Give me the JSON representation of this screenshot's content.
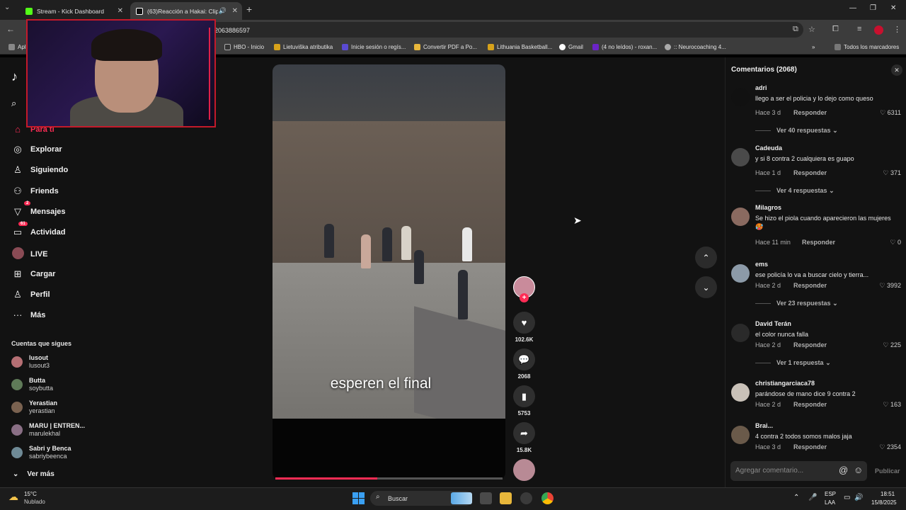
{
  "browser": {
    "tabs": [
      {
        "title": "Stream - Kick Dashboard",
        "favicon_color": "#53fc18"
      },
      {
        "title": "(63)Reacción a Hakai: Clips",
        "favicon_color": "#ffffff"
      }
    ],
    "url": "2063886597",
    "bookmarks": [
      {
        "label": "HBO - Inicio",
        "color": "#333333"
      },
      {
        "label": "Lietuviška atributika",
        "color": "#d7a21a"
      },
      {
        "label": "Inicie sesión o regís...",
        "color": "#5a4ad1"
      },
      {
        "label": "Convertir PDF a Po...",
        "color": "#e8b73b"
      },
      {
        "label": "Lithuania Basketball...",
        "color": "#d7a21a"
      },
      {
        "label": "Gmail",
        "color": "#ffffff"
      },
      {
        "label": "(4 no leídos) - roxan...",
        "color": "#6b24c7"
      },
      {
        "label": ":: Neurocoaching 4...",
        "color": "#aaaaaa"
      }
    ],
    "bookmarks_left": "Apl",
    "all_bookmarks": "Todos los marcadores"
  },
  "sidebar": {
    "items": [
      {
        "label": "Para ti",
        "icon": "home-icon",
        "badge": ""
      },
      {
        "label": "Explorar",
        "icon": "compass-icon",
        "badge": ""
      },
      {
        "label": "Siguiendo",
        "icon": "person-icon",
        "badge": ""
      },
      {
        "label": "Friends",
        "icon": "friends-icon",
        "badge": ""
      },
      {
        "label": "Mensajes",
        "icon": "send-icon",
        "badge": "2"
      },
      {
        "label": "Actividad",
        "icon": "inbox-icon",
        "badge": "61"
      },
      {
        "label": "LIVE",
        "icon": "live-icon",
        "badge": ""
      },
      {
        "label": "Cargar",
        "icon": "plus-square-icon",
        "badge": ""
      },
      {
        "label": "Perfil",
        "icon": "profile-icon",
        "badge": ""
      },
      {
        "label": "Más",
        "icon": "more-icon",
        "badge": ""
      }
    ],
    "following_title": "Cuentas que sigues",
    "accounts": [
      {
        "name": "lusout",
        "handle": "lusout3",
        "color": "#b56f74"
      },
      {
        "name": "Butta",
        "handle": "soybutta",
        "color": "#5f7a58"
      },
      {
        "name": "Yerastian",
        "handle": "yerastian",
        "color": "#7a6250"
      },
      {
        "name": "MARU | ENTREN...",
        "handle": "marulekhal",
        "color": "#8a6f85"
      },
      {
        "name": "Sabri y Benca",
        "handle": "sabriybeenca",
        "color": "#6f8a96"
      }
    ],
    "see_more": "Ver más"
  },
  "video": {
    "caption": "esperen el final",
    "progress": 0.45,
    "likes": "102.6K",
    "comments": "2068",
    "saves": "5753",
    "shares": "15.8K"
  },
  "comments": {
    "title": "Comentarios (2068)",
    "items": [
      {
        "user": "adri",
        "text": "llego a ser el policia y lo dejo como queso",
        "time": "Hace 3 d",
        "reply": "Responder",
        "likes": "6311",
        "view": "Ver 40 respuestas",
        "color": "#111111"
      },
      {
        "user": "Cadeuda",
        "text": "y si 8 contra 2 cualquiera es guapo",
        "time": "Hace 1 d",
        "reply": "Responder",
        "likes": "371",
        "view": "Ver 4 respuestas",
        "color": "#4a4a4a"
      },
      {
        "user": "Milagros",
        "text": "Se hizo el piola cuando aparecieron las mujeres 🥵",
        "time": "Hace 11 min",
        "reply": "Responder",
        "likes": "0",
        "view": "",
        "color": "#8a6a60"
      },
      {
        "user": "ems",
        "text": "ese policía lo va a buscar cielo y tierra...",
        "time": "Hace 2 d",
        "reply": "Responder",
        "likes": "3992",
        "view": "Ver 23 respuestas",
        "color": "#8c9aa8"
      },
      {
        "user": "David Terán",
        "text": "el color nunca falla",
        "time": "Hace 2 d",
        "reply": "Responder",
        "likes": "225",
        "view": "Ver 1 respuesta",
        "color": "#2a2a2a"
      },
      {
        "user": "christiangarciaca78",
        "text": "parándose de mano dice 9 contra 2",
        "time": "Hace 2 d",
        "reply": "Responder",
        "likes": "163",
        "view": "",
        "color": "#c9c1b8"
      },
      {
        "user": "Brai...",
        "text": "4 contra 2 todos somos malos jaja",
        "time": "Hace 3 d",
        "reply": "Responder",
        "likes": "2354",
        "view": "",
        "color": "#6a5a4a"
      }
    ],
    "add_placeholder": "Agregar comentario...",
    "publish": "Publicar"
  },
  "taskbar": {
    "temperature": "15°C",
    "condition": "Nublado",
    "search": "Buscar",
    "lang1": "ESP",
    "lang2": "LAA",
    "time": "18:51",
    "date": "15/8/2025"
  },
  "colors": {
    "accent": "#fe2c55",
    "panel": "#121212"
  }
}
